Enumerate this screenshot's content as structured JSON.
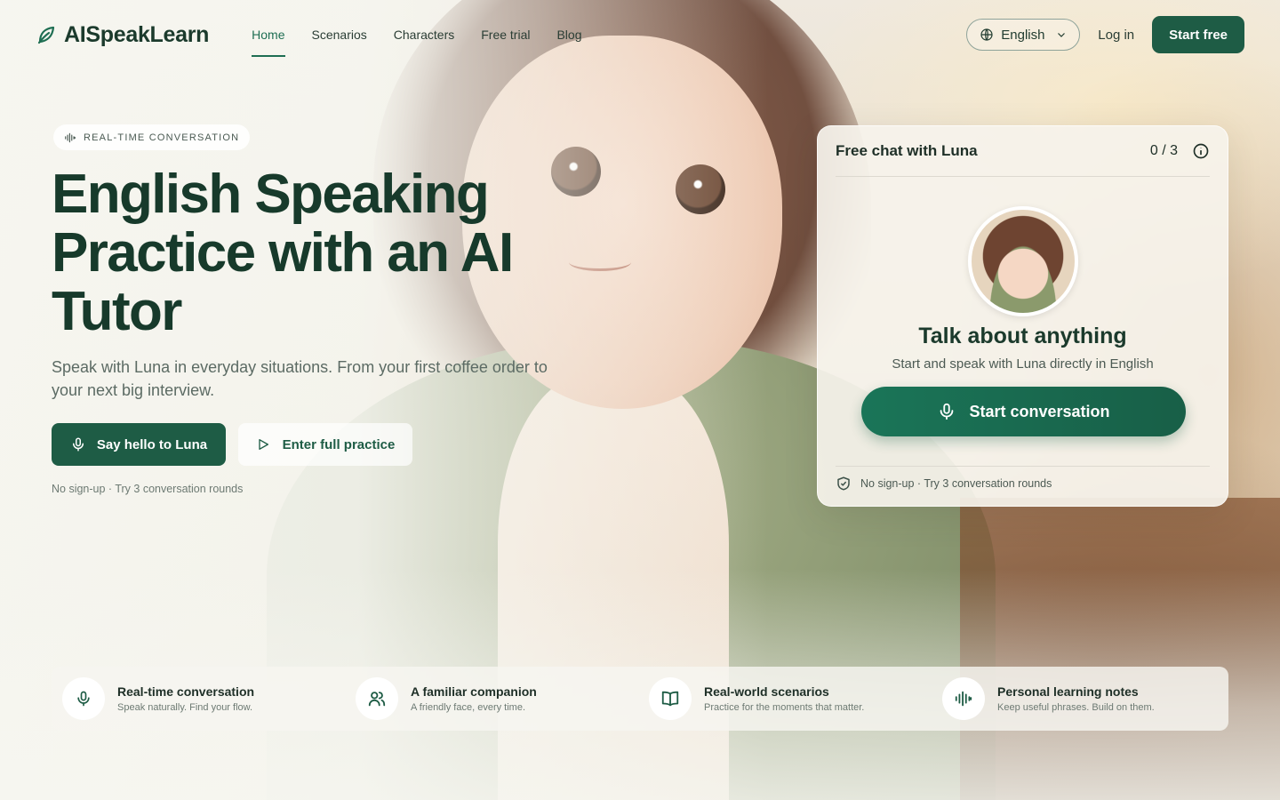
{
  "brand": {
    "name": "AISpeakLearn"
  },
  "nav": {
    "items": [
      {
        "label": "Home",
        "active": true
      },
      {
        "label": "Scenarios"
      },
      {
        "label": "Characters"
      },
      {
        "label": "Free trial"
      },
      {
        "label": "Blog"
      }
    ]
  },
  "header": {
    "language": "English",
    "login": "Log in",
    "start_free": "Start free"
  },
  "hero": {
    "badge": "REAL-TIME CONVERSATION",
    "title": "English Speaking Practice with an AI Tutor",
    "subtitle": "Speak with Luna in everyday situations. From your first coffee order to your next big interview.",
    "primary_button": "Say hello to Luna",
    "secondary_button": "Enter full practice",
    "note": "No sign-up · Try 3 conversation rounds"
  },
  "chat_card": {
    "title": "Free chat with Luna",
    "count": "0 / 3",
    "heading": "Talk about anything",
    "description": "Start and speak with Luna directly in English",
    "button": "Start conversation",
    "footer": "No sign-up · Try 3 conversation rounds"
  },
  "features": [
    {
      "icon": "microphone-icon",
      "title": "Real-time conversation",
      "desc": "Speak naturally. Find your flow."
    },
    {
      "icon": "users-icon",
      "title": "A familiar companion",
      "desc": "A friendly face, every time."
    },
    {
      "icon": "book-open-icon",
      "title": "Real-world scenarios",
      "desc": "Practice for the moments that matter."
    },
    {
      "icon": "soundwave-icon",
      "title": "Personal learning notes",
      "desc": "Keep useful phrases. Build on them."
    }
  ],
  "colors": {
    "brand_green": "#1e5c45",
    "accent_green": "#1a7558",
    "text_dark": "#173a2b"
  }
}
